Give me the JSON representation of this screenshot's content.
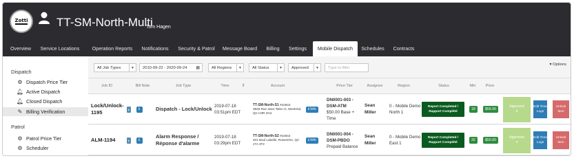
{
  "header": {
    "logo_text": "Zotti",
    "title": "TT-SM-North-Multi",
    "subtitle": "Tom Hagen"
  },
  "tabs": [
    {
      "label": "Overview"
    },
    {
      "label": "Service Locations"
    },
    {
      "label": "Operation Reports"
    },
    {
      "label": "Notifications"
    },
    {
      "label": "Security & Patrol"
    },
    {
      "label": "Message Board"
    },
    {
      "label": "Billing"
    },
    {
      "label": "Settings"
    },
    {
      "label": "Mobile Dispatch",
      "active": true
    },
    {
      "label": "Schedules"
    },
    {
      "label": "Contracts"
    }
  ],
  "sidebar": {
    "dispatch_heading": "Dispatch",
    "dispatch_items": [
      {
        "label": "Dispatch Price Tier",
        "icon": "gear-icon"
      },
      {
        "label": "Active Dispatch",
        "icon": "bell-icon"
      },
      {
        "label": "Closed Dispatch",
        "icon": "bell-icon"
      },
      {
        "label": "Billing Verification",
        "icon": "pencil-icon",
        "selected": true
      }
    ],
    "patrol_heading": "Patrol",
    "patrol_items": [
      {
        "label": "Patrol Price Tier",
        "icon": "gear-icon"
      },
      {
        "label": "Scheduler",
        "icon": "gear-icon"
      }
    ]
  },
  "filters": {
    "job_types": "All Job Types",
    "date_range": "2010-09-22 - 2020-09-24",
    "regions": "All Regions",
    "status": "All Status",
    "approved": "Approved",
    "search_placeholder": "Type to filter",
    "options_label": "Options"
  },
  "columns": {
    "job_id": "Job ID",
    "bill_note": "Bill Note",
    "job_type": "Job Type",
    "time": "Time",
    "account": "Account",
    "price_tier": "Price Tier",
    "assignee": "Assignee",
    "region": "Region",
    "status": "Status",
    "min": "Min",
    "price": "Price"
  },
  "rows": [
    {
      "job_id": "Lock/Unlock-1195",
      "job_type": "Dispatch - Lock/Unlock",
      "date": "2019-07-18",
      "time": "03:51pm EDT",
      "account_name": "TT-SM-North-S1",
      "account_num": "#22843",
      "account_addr": "3945 Rue Jean-Talon O, Montréal, QC H3R 2G4",
      "info_label": "Info",
      "tier_code": "DN0001-003 - DSM-ATM",
      "tier_detail": "$50.00 Base + Time",
      "assignee": "Sean Miller",
      "region": "0 - Mobile Demo North 1",
      "status": "Report Completed / Rapport Complété",
      "min": "18",
      "price": "$56.00",
      "approved": "Approved",
      "edit": "Edit Time Logs",
      "unlock": "Unlock Item"
    },
    {
      "job_id": "ALM-1194",
      "job_type": "Alarm Response / Réponse d'alarme",
      "date": "2019-07-18",
      "time": "03:29pm EDT",
      "account_name": "TT-SM-North-S2",
      "account_num": "#22844",
      "account_addr": "401 Boul Labelle, Rosemère, QC J7A 3T2",
      "info_label": "Info",
      "tier_code": "DN0001-004 - DSM-PBDO",
      "tier_detail": "Prepaid Balance",
      "assignee": "Sean Miller",
      "region": "0 - Mobile Demo East 1",
      "status": "Report Completed / Rapport Complété",
      "min": "32",
      "price": "$50.00",
      "approved": "Approved",
      "edit": "Edit Time Logs",
      "unlock": "Unlock Item"
    }
  ],
  "colors": {
    "header_bg": "#2c2c30",
    "status_green": "#0b5a1f",
    "badge_green": "#2e8b3e",
    "approved_green": "#b6d98b",
    "info_blue": "#2f7db5",
    "unlock_red": "#d66a6a"
  }
}
